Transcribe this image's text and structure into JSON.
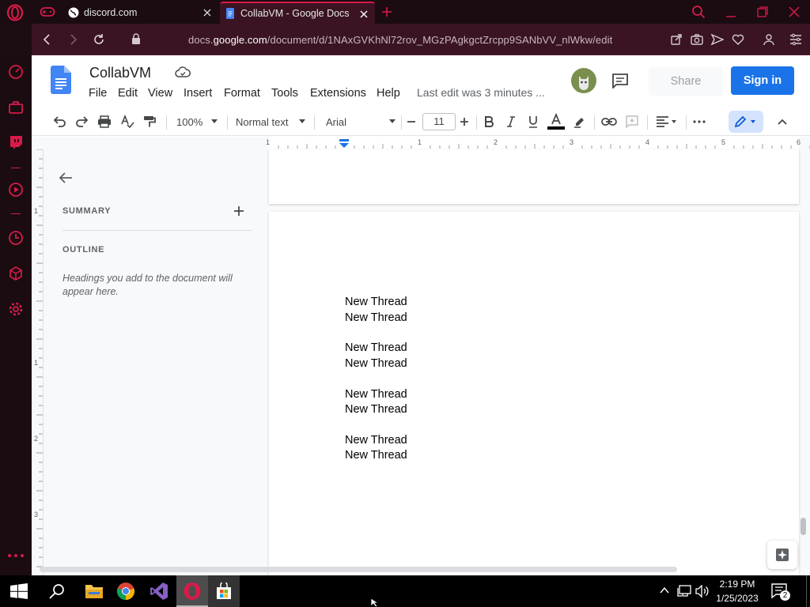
{
  "browser": {
    "tabs": [
      {
        "title": "discord.com"
      },
      {
        "title": "CollabVM - Google Docs"
      }
    ],
    "url_prefix": "docs.",
    "url_domain": "google.com",
    "url_path": "/document/d/1NAxGVKhNl72rov_MGzPAgkgctZrcpp9SANbVV_nlWkw/edit"
  },
  "docs": {
    "title": "CollabVM",
    "menus": [
      "File",
      "Edit",
      "View",
      "Insert",
      "Format",
      "Tools",
      "Extensions",
      "Help"
    ],
    "last_edit": "Last edit was 3 minutes ...",
    "share_label": "Share",
    "signin_label": "Sign in",
    "toolbar": {
      "zoom": "100%",
      "style": "Normal text",
      "font": "Arial",
      "font_size": "11"
    },
    "ruler_labels": [
      "1",
      "1",
      "2",
      "3",
      "4",
      "5",
      "6"
    ],
    "vruler_labels": [
      "1",
      "1",
      "2",
      "3"
    ],
    "outline": {
      "summary_label": "SUMMARY",
      "outline_label": "OUTLINE",
      "empty_hint": "Headings you add to the document will appear here."
    },
    "body_lines": [
      "New Thread",
      "New Thread",
      "New Thread",
      "New Thread",
      "New Thread",
      "New Thread",
      "New Thread",
      "New Thread"
    ]
  },
  "taskbar": {
    "time": "2:19 PM",
    "date": "1/25/2023",
    "notification_count": "2"
  },
  "colors": {
    "opera_red": "#d81a4a",
    "docs_blue": "#1a73e8",
    "addr_bg": "#3a1422"
  }
}
